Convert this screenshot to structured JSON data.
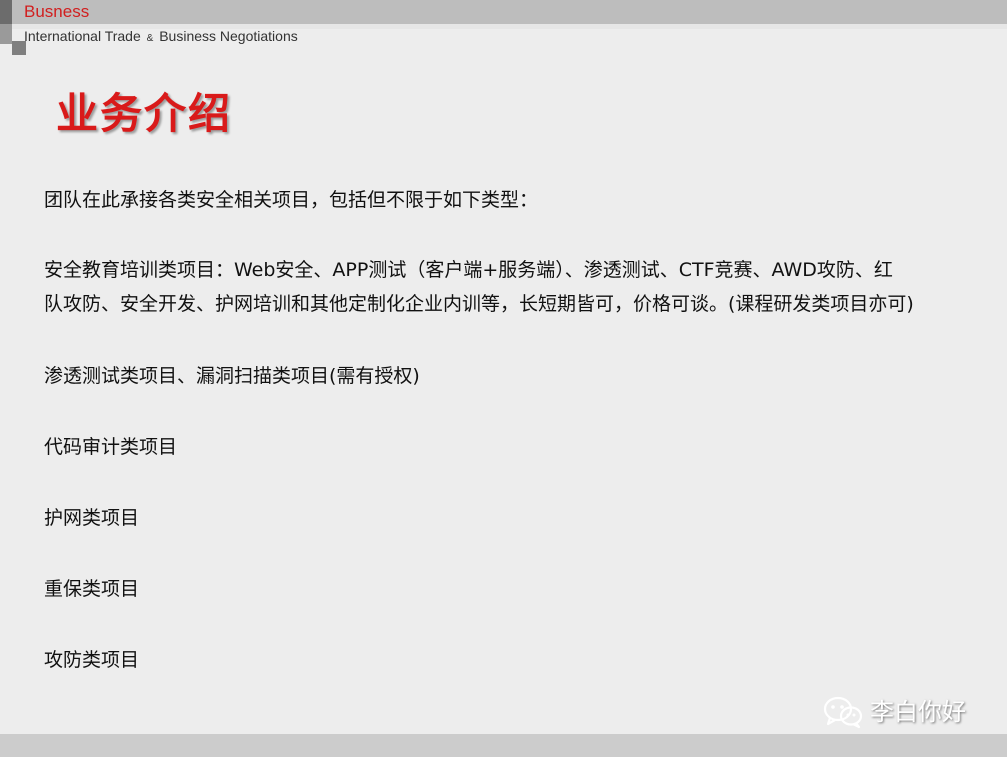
{
  "header": {
    "brand": "Busness",
    "subtitle_part1": "International Trade",
    "subtitle_amp": "&",
    "subtitle_part2": "Business Negotiations"
  },
  "slide": {
    "title": "业务介绍",
    "intro": "团队在此承接各类安全相关项目，包括但不限于如下类型：",
    "education_line1": "安全教育培训类项目：Web安全、APP测试（客户端+服务端）、渗透测试、CTF竞赛、AWD攻防、红",
    "education_line2": "队攻防、安全开发、护网培训和其他定制化企业内训等，长短期皆可，价格可谈。(课程研发类项目亦可)",
    "pentest": "渗透测试类项目、漏洞扫描类项目(需有授权)",
    "code_audit": "代码审计类项目",
    "hw": "护网类项目",
    "zb": "重保类项目",
    "gf": "攻防类项目"
  },
  "watermark": {
    "icon": "wechat-icon",
    "text": "李白你好"
  },
  "colors": {
    "brand_red": "#d11f1f",
    "title_red": "#d91a1a",
    "background": "#ededed",
    "header_bar": "#bdbdbd"
  }
}
